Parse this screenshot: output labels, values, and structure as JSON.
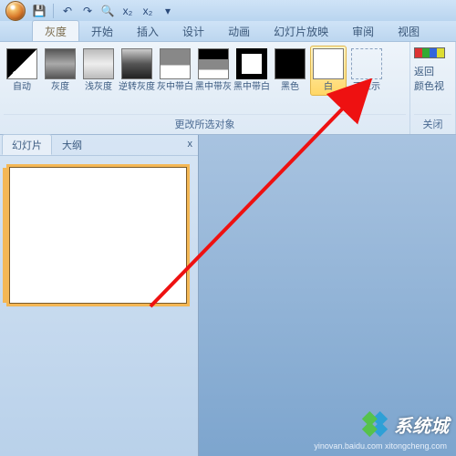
{
  "qat": {
    "save": "💾",
    "undo": "↶",
    "redo": "↷",
    "print": "🔍"
  },
  "tabs": {
    "items": [
      "灰度",
      "开始",
      "插入",
      "设计",
      "动画",
      "幻灯片放映",
      "审阅",
      "视图"
    ],
    "active": 0
  },
  "ribbon": {
    "group_label": "更改所选对象",
    "swatches": [
      {
        "label": "自动",
        "cls": "g-auto"
      },
      {
        "label": "灰度",
        "cls": "g-gray"
      },
      {
        "label": "浅灰度",
        "cls": "g-lightgray"
      },
      {
        "label": "逆转灰度",
        "cls": "g-invert"
      },
      {
        "label": "灰中带白",
        "cls": "g-gw"
      },
      {
        "label": "黑中带灰",
        "cls": "g-bgw"
      },
      {
        "label": "黑中带白",
        "cls": "g-bw"
      },
      {
        "label": "黑色",
        "cls": "g-black"
      },
      {
        "label": "白",
        "cls": "g-white",
        "selected": true
      },
      {
        "label": "不显示",
        "cls": "",
        "none": true
      }
    ],
    "right": {
      "line1": "返回",
      "line2": "颜色视",
      "group": "关闭"
    }
  },
  "leftpane": {
    "tabs": [
      "幻灯片",
      "大纲"
    ],
    "active": 0,
    "close": "x"
  },
  "watermark": {
    "main": "系统城",
    "sub": "yinovan.baidu.com  xitongcheng.com"
  }
}
